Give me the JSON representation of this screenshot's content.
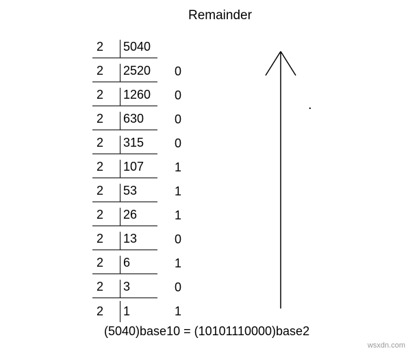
{
  "header": "Remainder",
  "stray_dot": ".",
  "division": {
    "divisor": "2",
    "rows": [
      {
        "quotient": "5040",
        "remainder": ""
      },
      {
        "quotient": "2520",
        "remainder": "0"
      },
      {
        "quotient": "1260",
        "remainder": "0"
      },
      {
        "quotient": "630",
        "remainder": "0"
      },
      {
        "quotient": "315",
        "remainder": "0"
      },
      {
        "quotient": "107",
        "remainder": "1"
      },
      {
        "quotient": "53",
        "remainder": "1"
      },
      {
        "quotient": "26",
        "remainder": "1"
      },
      {
        "quotient": "13",
        "remainder": "0"
      },
      {
        "quotient": "6",
        "remainder": "1"
      },
      {
        "quotient": "3",
        "remainder": "0"
      },
      {
        "quotient": "1",
        "remainder": "1"
      }
    ]
  },
  "result": "(5040)base10 = (10101110000)base2",
  "watermark": "wsxdn.com"
}
